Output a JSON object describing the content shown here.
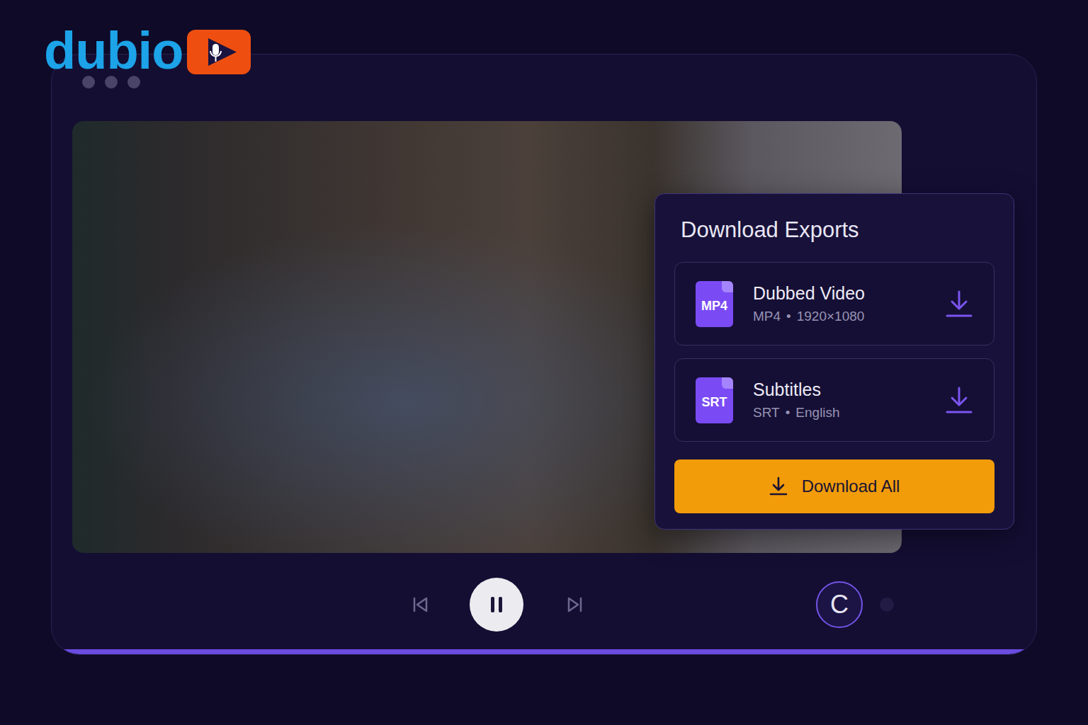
{
  "logo": {
    "text": "dubio"
  },
  "player": {
    "playing": true
  },
  "exports_panel": {
    "title": "Download Exports",
    "items": [
      {
        "name": "Dubbed Video",
        "badge": "MP4",
        "format": "MP4",
        "separator": "•",
        "detail": "1920×1080"
      },
      {
        "name": "Subtitles",
        "badge": "SRT",
        "format": "SRT",
        "separator": "•",
        "detail": "English"
      }
    ],
    "download_all": "Download All"
  },
  "user": {
    "avatar": "C"
  }
}
